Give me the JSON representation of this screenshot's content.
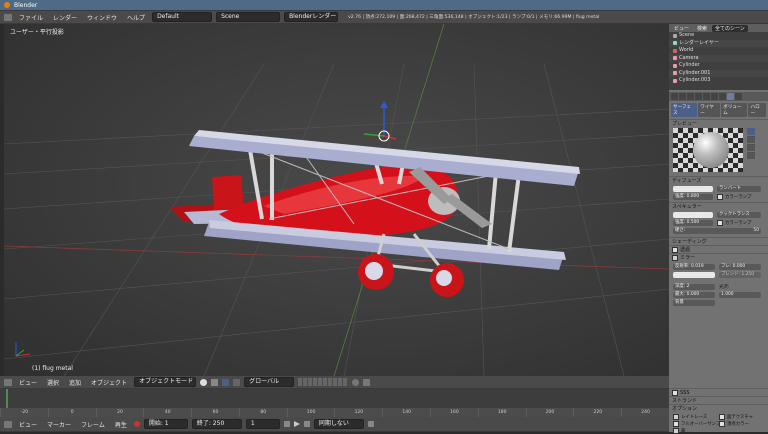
{
  "app": {
    "title": "Blender"
  },
  "menubar": {
    "menus": [
      "ファイル",
      "レンダー",
      "ウィンドウ",
      "ヘルプ"
    ],
    "layout": "Default",
    "scene": "Scene",
    "engine": "Blenderレンダー",
    "info": "v2.76 | 頂点:272,109 | 面:268,472 | 三角面:536,148 | オブジェクト:1/23 | ランプ:0/1 | メモリ:66.99M | flug metal"
  },
  "viewport": {
    "label": "ユーザー・平行投影",
    "object_label": "(1) flug metal"
  },
  "outliner": {
    "tabs": [
      "ビュー",
      "検索",
      "全てのシーン"
    ],
    "rows": [
      {
        "label": "Scene",
        "color": "#aaa"
      },
      {
        "label": "レンダーレイヤー",
        "color": "#8db"
      },
      {
        "label": "World",
        "color": "#c66"
      },
      {
        "label": "Camera",
        "color": "#e9a"
      },
      {
        "label": "Cylinder",
        "color": "#e9a"
      },
      {
        "label": "Cylinder.001",
        "color": "#e9a"
      },
      {
        "label": "Cylinder.003",
        "color": "#e9a"
      }
    ]
  },
  "properties": {
    "mat_tabs": [
      "サーフェス",
      "ワイヤー",
      "ボリューム",
      "ハロー"
    ],
    "preview": "プレビュー",
    "diffuse": "ディフューズ",
    "diffuse_shader": "ランバート",
    "diffuse_intensity": "強度: 0.800",
    "ramp": "カラーランプ",
    "specular": "スペキュラー",
    "specular_shader": "クックトランス",
    "spec_intensity": "強度: 0.500",
    "hardness": "硬さ:",
    "hardness_value": "50",
    "shading": "シェーディング",
    "transparency": "透過",
    "mirror": "ミラー",
    "reflectivity": "反射率: 0.019",
    "fresnel": "フレ: 0.000",
    "blend": "ブレンド: 1.250",
    "depth": "深度: 2",
    "max_dist": "最大: 0.000",
    "gloss": "光沢:",
    "gloss_amount": "1.000",
    "fade": "背景",
    "sss": "SSS",
    "strand": "ストランド",
    "options": "オプション",
    "opt_raytrace": "レイトレース",
    "opt_fullosa": "フルオーバーサンプル",
    "opt_fog": "霧",
    "opt_mist": "ミスト影",
    "opt_face_tex": "面テクスチャ",
    "opt_vcol": "頂点カラー",
    "opt_vcol2": "頂点カラー",
    "opt_light": "頂点カラー"
  },
  "footer": {
    "menus": [
      "ビュー",
      "選択",
      "追加",
      "オブジェクト"
    ],
    "mode": "オブジェクトモード",
    "pivot": "グローバル"
  },
  "timeline": {
    "ticks": [
      "-20",
      "0",
      "20",
      "40",
      "60",
      "80",
      "100",
      "120",
      "140",
      "160",
      "180",
      "200",
      "220",
      "240"
    ],
    "menus": [
      "ビュー",
      "マーカー",
      "フレーム",
      "再生"
    ],
    "start": "開始: 1",
    "end": "終了: 250",
    "current": "1",
    "sync": "同期しない"
  }
}
